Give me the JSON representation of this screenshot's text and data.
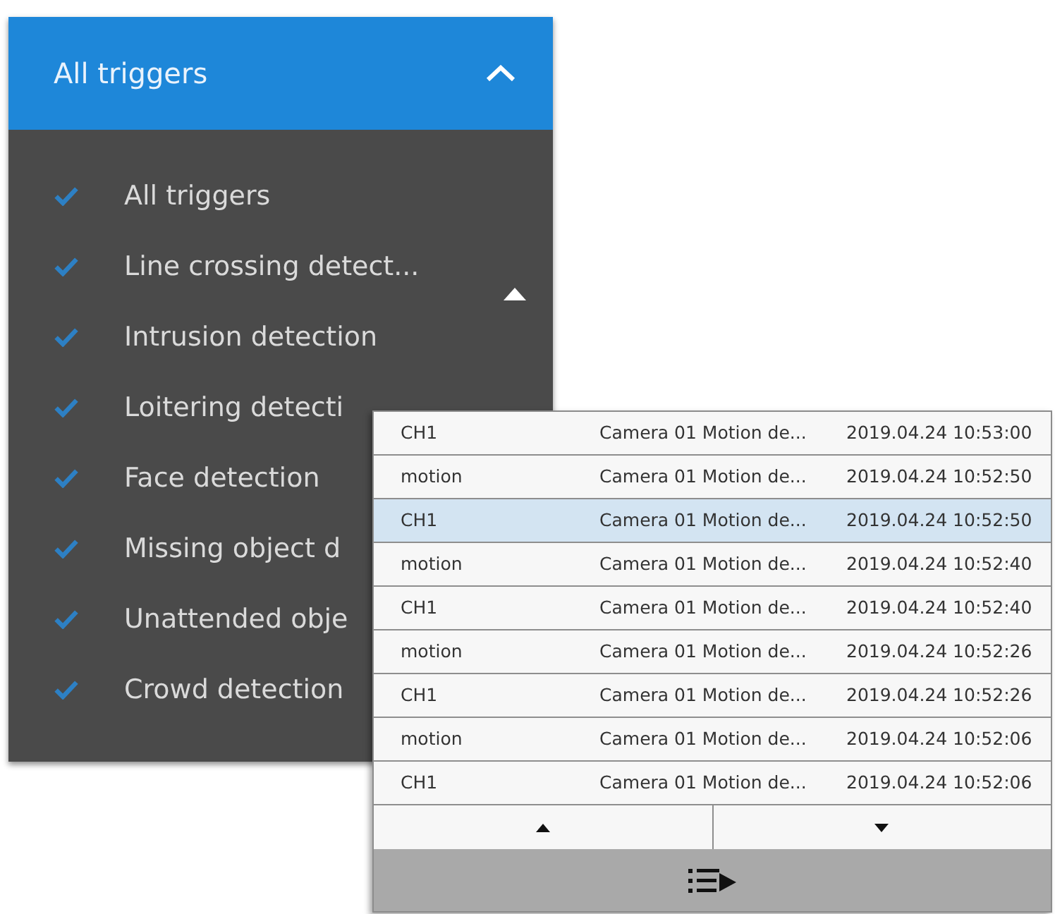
{
  "dropdown": {
    "title": "All triggers",
    "expanded": true
  },
  "triggers": [
    {
      "label": "All triggers",
      "checked": true
    },
    {
      "label": "Line crossing detect...",
      "checked": true
    },
    {
      "label": "Intrusion detection",
      "checked": true
    },
    {
      "label": "Loitering detecti",
      "checked": true
    },
    {
      "label": "Face detection",
      "checked": true
    },
    {
      "label": "Missing object d",
      "checked": true
    },
    {
      "label": "Unattended obje",
      "checked": true
    },
    {
      "label": "Crowd detection",
      "checked": true
    }
  ],
  "events": {
    "rows": [
      {
        "column_1": "CH1",
        "column_2": "Camera 01 Motion de...",
        "column_3": "2019.04.24 10:53:00",
        "selected": false
      },
      {
        "column_1": "motion",
        "column_2": "Camera 01 Motion de...",
        "column_3": "2019.04.24 10:52:50",
        "selected": false
      },
      {
        "column_1": "CH1",
        "column_2": "Camera 01 Motion de...",
        "column_3": "2019.04.24 10:52:50",
        "selected": true
      },
      {
        "column_1": "motion",
        "column_2": "Camera 01 Motion de...",
        "column_3": "2019.04.24 10:52:40",
        "selected": false
      },
      {
        "column_1": "CH1",
        "column_2": "Camera 01 Motion de...",
        "column_3": "2019.04.24 10:52:40",
        "selected": false
      },
      {
        "column_1": "motion",
        "column_2": "Camera 01 Motion de...",
        "column_3": "2019.04.24 10:52:26",
        "selected": false
      },
      {
        "column_1": "CH1",
        "column_2": "Camera 01 Motion de...",
        "column_3": "2019.04.24 10:52:26",
        "selected": false
      },
      {
        "column_1": "motion",
        "column_2": "Camera 01 Motion de...",
        "column_3": "2019.04.24 10:52:06",
        "selected": false
      },
      {
        "column_1": "CH1",
        "column_2": "Camera 01 Motion de...",
        "column_3": "2019.04.24 10:52:06",
        "selected": false
      }
    ]
  }
}
